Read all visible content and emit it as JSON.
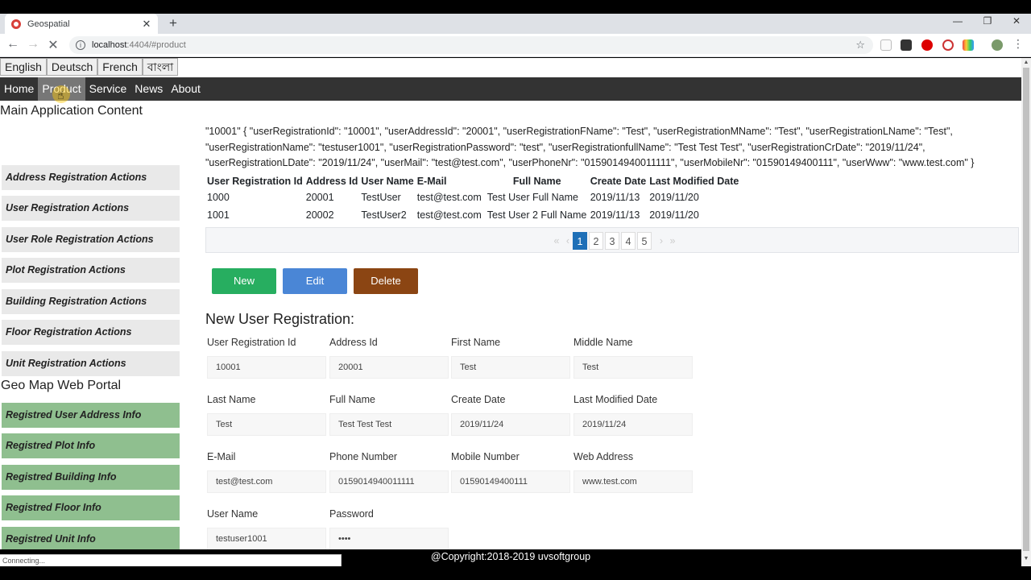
{
  "browser": {
    "tab_title": "Geospatial",
    "url_host": "localhost",
    "url_path": ":4404/#product"
  },
  "languages": [
    "English",
    "Deutsch",
    "French",
    "বাংলা"
  ],
  "nav": [
    "Home",
    "Product",
    "Service",
    "News",
    "About"
  ],
  "main_title": "Main Application Content",
  "sidebar_actions": [
    "Address Registration Actions",
    "User Registration Actions",
    "User Role Registration Actions",
    "Plot Registration Actions",
    "Building Registration Actions",
    "Floor Registration Actions",
    "Unit Registration Actions"
  ],
  "geo_title": "Geo Map Web Portal",
  "sidebar_info": [
    "Registred User Address Info",
    "Registred Plot Info",
    "Registred Building Info",
    "Registred Floor Info",
    "Registred Unit Info"
  ],
  "json_text": "\"10001\" { \"userRegistrationId\": \"10001\", \"userAddressId\": \"20001\", \"userRegistrationFName\": \"Test\", \"userRegistrationMName\": \"Test\", \"userRegistrationLName\": \"Test\", \"userRegistrationName\": \"testuser1001\", \"userRegistrationPassword\": \"test\", \"userRegistrationfullName\": \"Test Test Test\", \"userRegistrationCrDate\": \"2019/11/24\", \"userRegistrationLDate\": \"2019/11/24\", \"userMail\": \"test@test.com\", \"userPhoneNr\": \"0159014940011111\", \"userMobileNr\": \"01590149400111\", \"userWww\": \"www.test.com\" }",
  "table": {
    "headers": [
      "User Registration Id",
      "Address Id",
      "User Name",
      "E-Mail",
      "Full Name",
      "Create Date",
      "Last Modified Date"
    ],
    "rows": [
      [
        "1000",
        "20001",
        "TestUser",
        "test@test.com",
        "Test User Full Name",
        "2019/11/13",
        "2019/11/20"
      ],
      [
        "1001",
        "20002",
        "TestUser2",
        "test@test.com",
        "Test User 2 Full Name",
        "2019/11/13",
        "2019/11/20"
      ]
    ]
  },
  "pager": {
    "pages": [
      "1",
      "2",
      "3",
      "4",
      "5"
    ],
    "active": "1"
  },
  "buttons": {
    "new": "New",
    "edit": "Edit",
    "delete": "Delete"
  },
  "form": {
    "title": "New User Registration:",
    "fields": [
      {
        "label": "User Registration Id",
        "value": "10001"
      },
      {
        "label": "Address Id",
        "value": "20001"
      },
      {
        "label": "First Name",
        "value": "Test"
      },
      {
        "label": "Middle Name",
        "value": "Test"
      },
      {
        "label": "Last Name",
        "value": "Test"
      },
      {
        "label": "Full Name",
        "value": "Test Test Test"
      },
      {
        "label": "Create Date",
        "value": "2019/11/24"
      },
      {
        "label": "Last Modified Date",
        "value": "2019/11/24"
      },
      {
        "label": "E-Mail",
        "value": "test@test.com"
      },
      {
        "label": "Phone Number",
        "value": "0159014940011111"
      },
      {
        "label": "Mobile Number",
        "value": "01590149400111"
      },
      {
        "label": "Web Address",
        "value": "www.test.com"
      },
      {
        "label": "User Name",
        "value": "testuser1001"
      },
      {
        "label": "Password",
        "value": "••••"
      }
    ]
  },
  "footer": "@Copyright:2018-2019 uvsoftgroup",
  "status": "Connecting..."
}
